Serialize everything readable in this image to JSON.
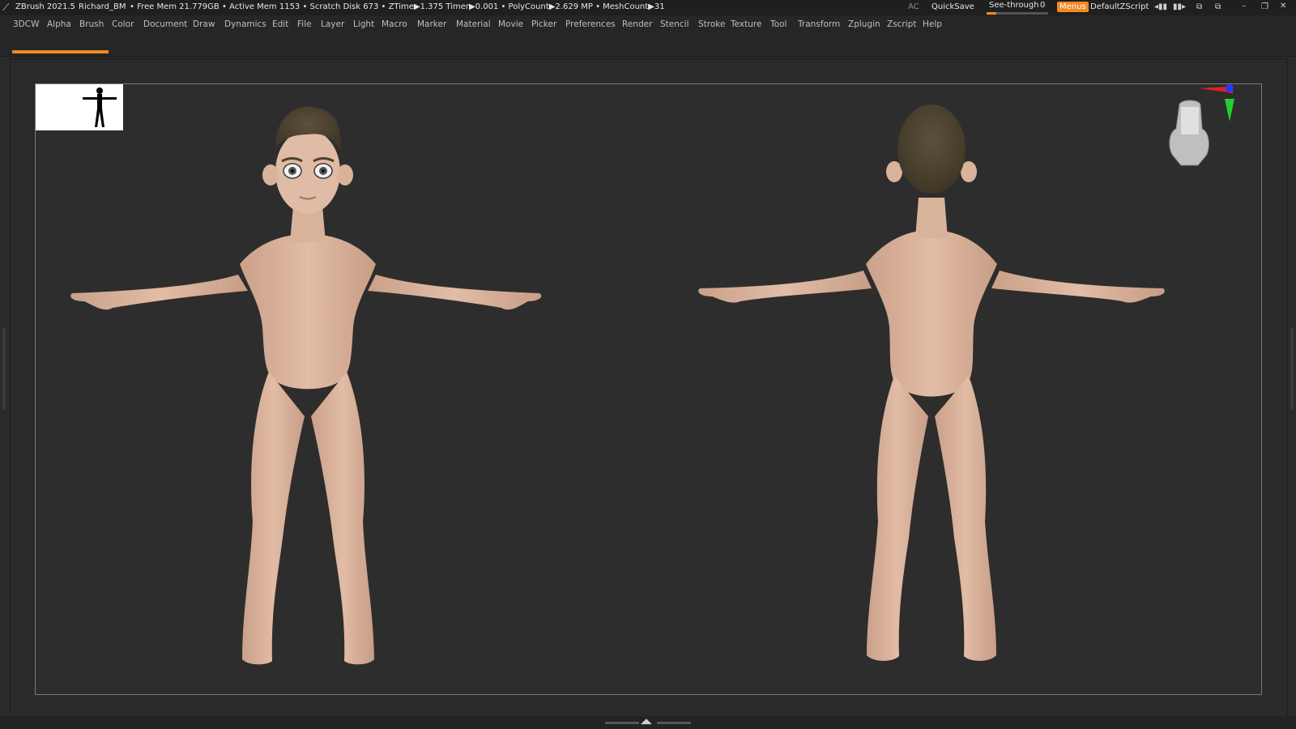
{
  "app": {
    "title": "ZBrush 2021.5",
    "project": "Richard_BM",
    "status": "• Free Mem 21.779GB • Active Mem 1153 • Scratch Disk 673 •  ZTime▶1.375 Timer▶0.001 • PolyCount▶2.629 MP  • MeshCount▶31"
  },
  "titlebar": {
    "ac_label": "AC",
    "quicksave_label": "QuickSave",
    "seethrough_label": "See-through",
    "seethrough_value": "0",
    "menus_label": "Menus",
    "zscript_label": "DefaultZScript"
  },
  "menu": [
    "3DCW",
    "Alpha",
    "Brush",
    "Color",
    "Document",
    "Draw",
    "Dynamics",
    "Edit",
    "File",
    "Layer",
    "Light",
    "Macro",
    "Marker",
    "Material",
    "Movie",
    "Picker",
    "Preferences",
    "Render",
    "Stencil",
    "Stroke",
    "Texture",
    "Tool",
    "Transform",
    "Zplugin",
    "Zscript",
    "Help"
  ],
  "colors": {
    "accent": "#f08a24",
    "skin": "#dcb49c",
    "hair": "#4e4431",
    "background": "#2b2b2b"
  },
  "icons": [
    "zbrush-logo-icon",
    "minimize-icon",
    "restore-icon",
    "close-icon",
    "gizmo-axis-icon",
    "navigation-cube-icon",
    "figure-silhouette-icon"
  ]
}
